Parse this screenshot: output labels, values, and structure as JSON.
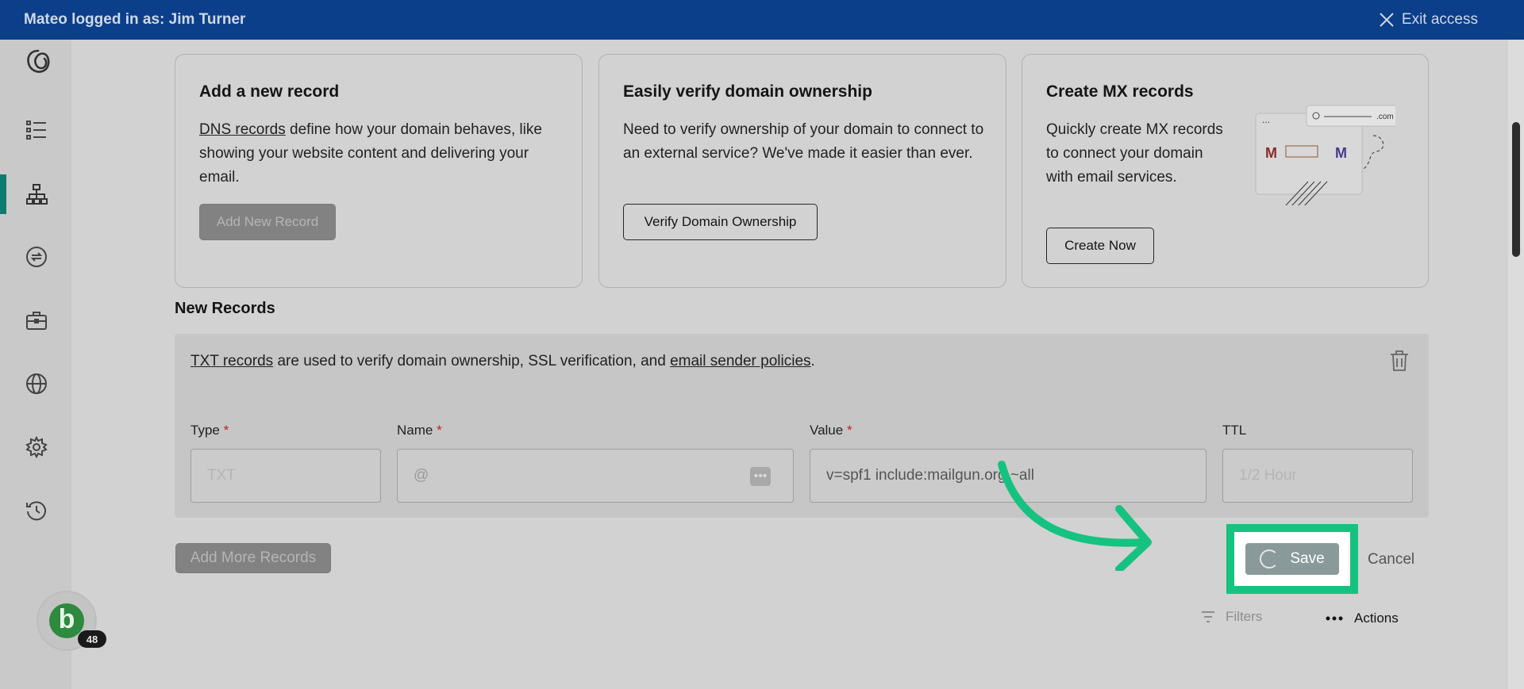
{
  "banner": {
    "logged_in_text": "Mateo logged in as: Jim Turner",
    "exit_label": "Exit access"
  },
  "sidebar": {
    "items": [
      {
        "icon": "list-icon"
      },
      {
        "icon": "sitemap-icon",
        "active": true
      },
      {
        "icon": "transfer-icon"
      },
      {
        "icon": "briefcase-icon"
      },
      {
        "icon": "globe-icon"
      },
      {
        "icon": "gear-icon"
      },
      {
        "icon": "history-icon"
      }
    ],
    "avatar": {
      "letter": "b",
      "badge_count": "48"
    }
  },
  "cards": [
    {
      "title": "Add a new record",
      "link_text": "DNS records",
      "body": " define how your domain behaves, like showing your website content and delivering your email.",
      "button": "Add New Record"
    },
    {
      "title": "Easily verify domain ownership",
      "body": "Need to verify ownership of your domain to connect to an external service? We've made it easier than ever.",
      "button": "Verify Domain Ownership"
    },
    {
      "title": "Create MX records",
      "body": "Quickly create MX records to connect your domain with email services.",
      "button": "Create Now",
      "illustration_text": ".com"
    }
  ],
  "new_records": {
    "title": "New Records",
    "desc_link1": "TXT records",
    "desc_mid": " are used to verify domain ownership, SSL verification, and ",
    "desc_link2": "email sender policies",
    "desc_end": ".",
    "fields": {
      "type": {
        "label": "Type",
        "required": "*",
        "placeholder": "TXT"
      },
      "name": {
        "label": "Name",
        "required": "*",
        "placeholder": "@"
      },
      "value": {
        "label": "Value",
        "required": "*",
        "value": "v=spf1 include:mailgun.org ~all"
      },
      "ttl": {
        "label": "TTL",
        "placeholder": "1/2 Hour"
      }
    }
  },
  "footer": {
    "add_more": "Add More Records",
    "save": "Save",
    "cancel": "Cancel",
    "filters": "Filters",
    "actions": "Actions"
  },
  "colors": {
    "banner": "#0b3f8a",
    "highlight": "#16c27f",
    "active_nav": "#0f7a6e",
    "avatar": "#2d8a3e"
  }
}
